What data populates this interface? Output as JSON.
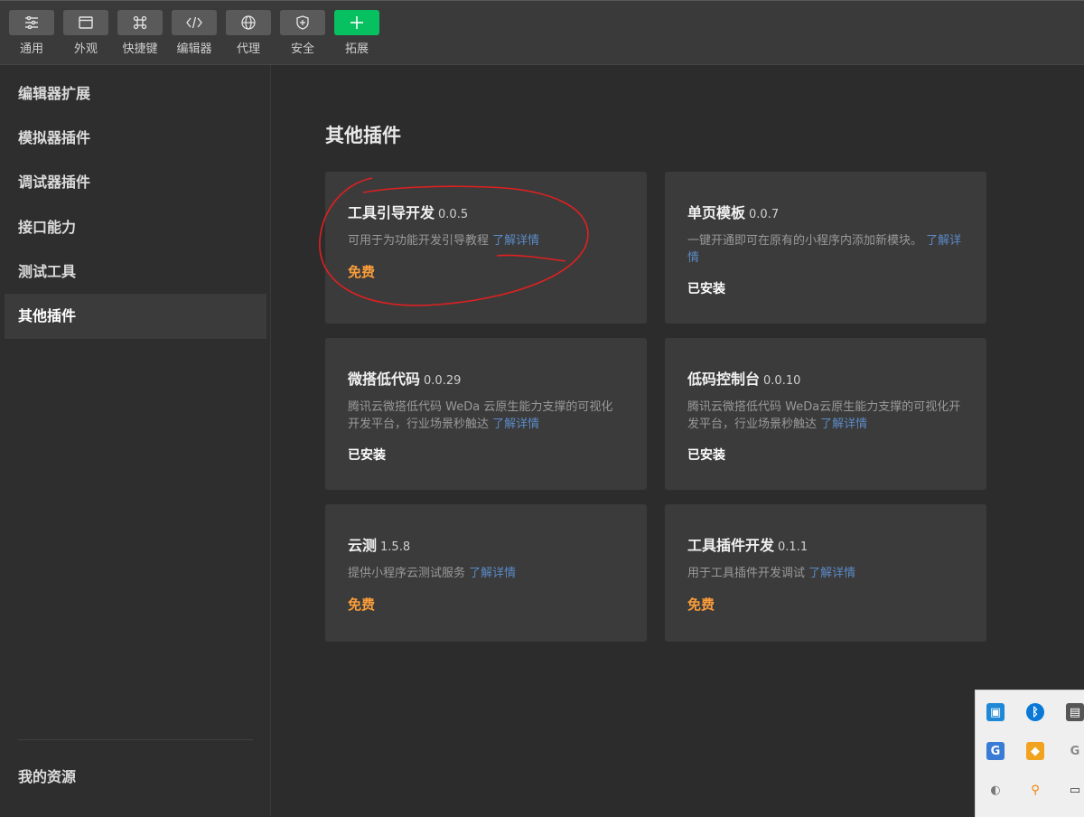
{
  "toolbar": {
    "items": [
      {
        "label": "通用",
        "icon": "settings-sliders-icon"
      },
      {
        "label": "外观",
        "icon": "window-icon"
      },
      {
        "label": "快捷键",
        "icon": "command-key-icon"
      },
      {
        "label": "编辑器",
        "icon": "code-icon"
      },
      {
        "label": "代理",
        "icon": "globe-icon"
      },
      {
        "label": "安全",
        "icon": "shield-icon"
      },
      {
        "label": "拓展",
        "icon": "plus-icon"
      }
    ],
    "accent_color": "#07c160"
  },
  "sidebar": {
    "items": [
      {
        "label": "编辑器扩展"
      },
      {
        "label": "模拟器插件"
      },
      {
        "label": "调试器插件"
      },
      {
        "label": "接口能力"
      },
      {
        "label": "测试工具"
      },
      {
        "label": "其他插件",
        "active": true
      }
    ],
    "footer": "我的资源"
  },
  "main": {
    "title": "其他插件",
    "link_color": "#5b8ac6",
    "free_color": "#fa9d3b",
    "cards": [
      {
        "title": "工具引导开发",
        "version": "0.0.5",
        "desc": "可用于为功能开发引导教程",
        "link": "了解详情",
        "status": "免费"
      },
      {
        "title": "单页模板",
        "version": "0.0.7",
        "desc": "一键开通即可在原有的小程序内添加新模块。",
        "link": "了解详情",
        "status": "已安装"
      },
      {
        "title": "微搭低代码",
        "version": "0.0.29",
        "desc": "腾讯云微搭低代码 WeDa 云原生能力支撑的可视化开发平台，行业场景秒触达",
        "link": "了解详情",
        "status": "已安装"
      },
      {
        "title": "低码控制台",
        "version": "0.0.10",
        "desc": "腾讯云微搭低代码 WeDa云原生能力支撑的可视化开发平台，行业场景秒触达",
        "link": "了解详情",
        "status": "已安装"
      },
      {
        "title": "云测",
        "version": "1.5.8",
        "desc": "提供小程序云测试服务",
        "link": "了解详情",
        "status": "免费"
      },
      {
        "title": "工具插件开发",
        "version": "0.1.1",
        "desc": "用于工具插件开发调试",
        "link": "了解详情",
        "status": "免费"
      }
    ]
  },
  "tray": {
    "icons": [
      "monitor-app-icon",
      "bluetooth-icon",
      "keyboard-icon",
      "g-app-icon",
      "shield-app-icon",
      "g-grey-icon",
      "q-app-icon",
      "search-app-icon",
      "battery-icon"
    ]
  }
}
